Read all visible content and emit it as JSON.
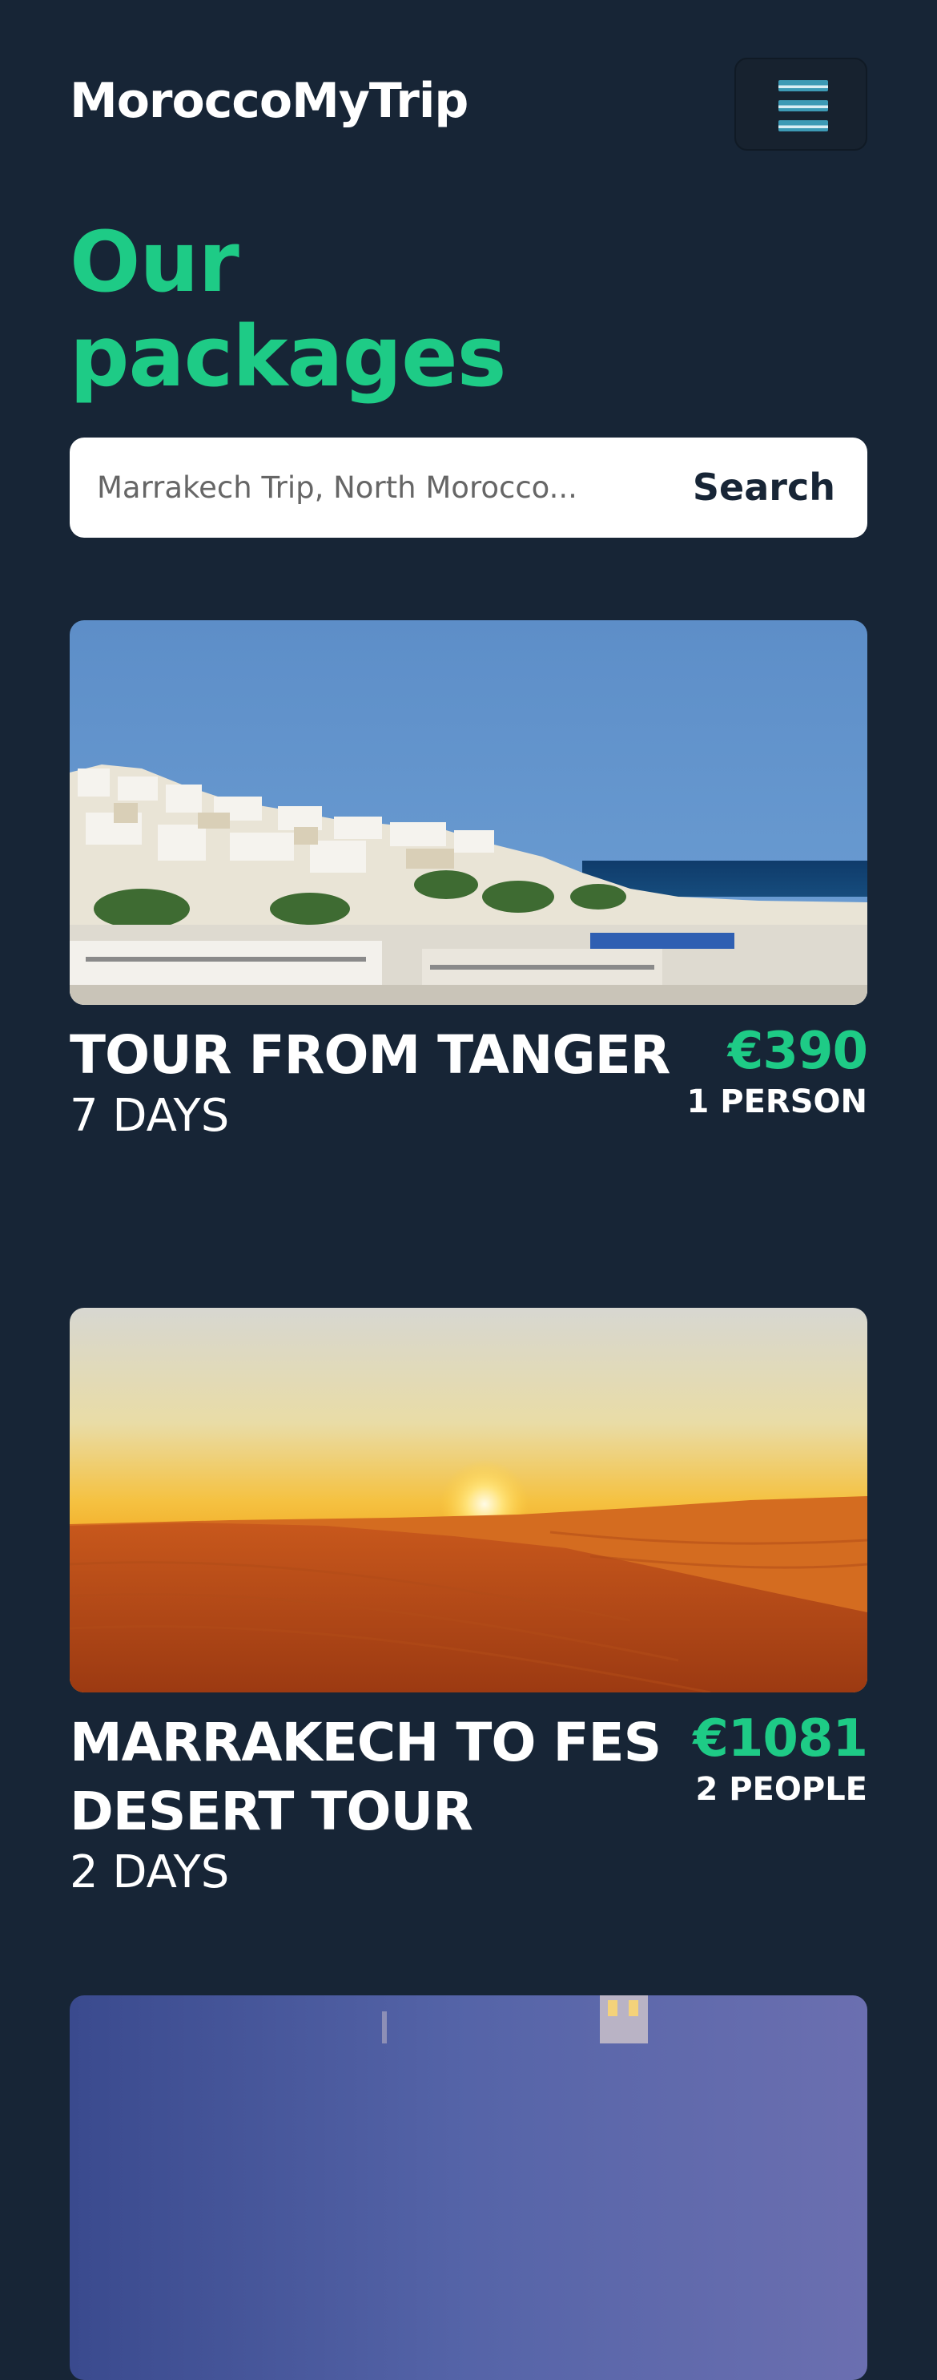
{
  "header": {
    "logo": "MoroccoMyTrip",
    "menu_icon": "hamburger-menu-icon"
  },
  "page": {
    "title": "Our packages"
  },
  "search": {
    "placeholder": "Marrakech Trip, North Morocco...",
    "button_label": "Search"
  },
  "packages": [
    {
      "title": "TOUR FROM TANGER",
      "duration": "7 DAYS",
      "price": "€390",
      "people": "1 PERSON",
      "image": "tangier-white-city-coast-photo"
    },
    {
      "title": "MARRAKECH TO FES DESERT TOUR",
      "duration": "2 DAYS",
      "price": "€1081",
      "people": "2 PEOPLE",
      "image": "sahara-desert-sunset-photo"
    },
    {
      "image": "evening-sky-tower-photo"
    }
  ],
  "colors": {
    "background": "#172536",
    "accent": "#1ecb86",
    "card_text": "#ffffff",
    "search_bg": "#ffffff",
    "search_button_text": "#172536"
  }
}
